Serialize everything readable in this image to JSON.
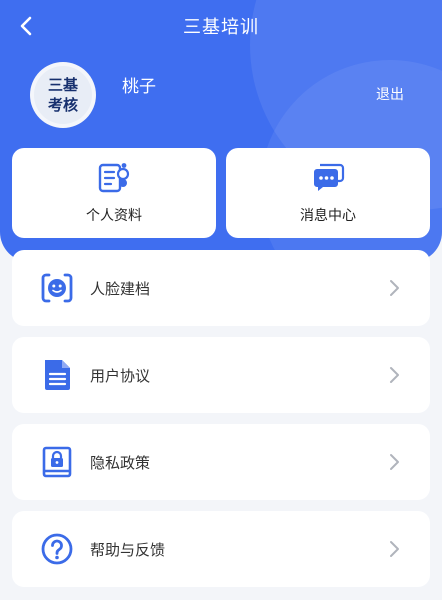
{
  "header": {
    "title": "三基培训"
  },
  "profile": {
    "avatar_line1": "三基",
    "avatar_line2": "考核",
    "username": "桃子",
    "logout_label": "退出"
  },
  "quick_actions": [
    {
      "label": "个人资料",
      "icon": "profile-doc-icon"
    },
    {
      "label": "消息中心",
      "icon": "message-icon"
    }
  ],
  "menu": [
    {
      "label": "人脸建档",
      "icon": "face-scan-icon"
    },
    {
      "label": "用户协议",
      "icon": "document-icon"
    },
    {
      "label": "隐私政策",
      "icon": "lock-book-icon"
    },
    {
      "label": "帮助与反馈",
      "icon": "question-icon"
    }
  ],
  "colors": {
    "primary": "#3f6ef0",
    "background": "#f3f5f9",
    "icon_blue": "#3b6be8"
  }
}
